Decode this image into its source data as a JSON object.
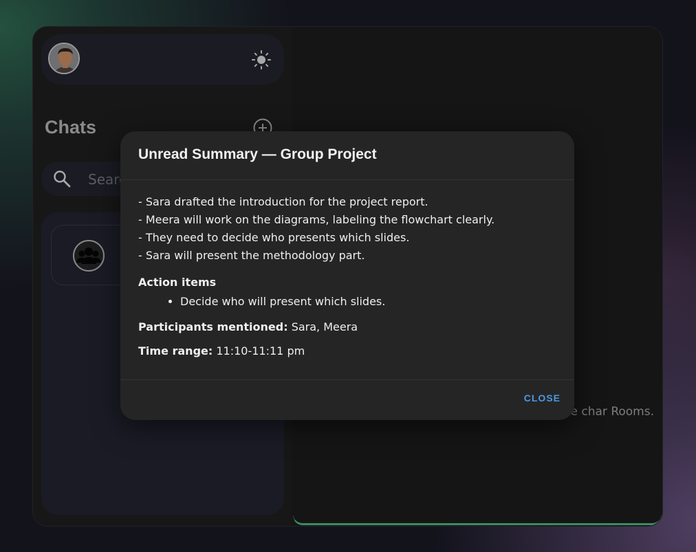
{
  "sidebar": {
    "chats_title": "Chats",
    "search": {
      "placeholder": "Search"
    },
    "icons": {
      "theme_toggle": "sun-icon",
      "add_chat": "plus-circle-icon",
      "search": "search-icon",
      "group": "group-icon"
    }
  },
  "main": {
    "welcome_text": "Welcome to the char Rooms."
  },
  "modal": {
    "title": "Unread Summary — Group Project",
    "lines": [
      "- Sara drafted the introduction for the project report.",
      "- Meera will work on the diagrams, labeling the flowchart clearly.",
      "- They need to decide who presents which slides.",
      "- Sara will present the methodology part."
    ],
    "action_items_heading": "Action items",
    "action_items": [
      "Decide who will present which slides."
    ],
    "participants_label": "Participants mentioned:",
    "participants_value": " Sara, Meera",
    "time_range_label": "Time range:",
    "time_range_value": " 11:10-11:11 pm",
    "close_label": "CLOSE"
  },
  "colors": {
    "accent": "#4a9ae4",
    "bottom_border": "#3b8c62",
    "modal_bg": "#252525"
  }
}
